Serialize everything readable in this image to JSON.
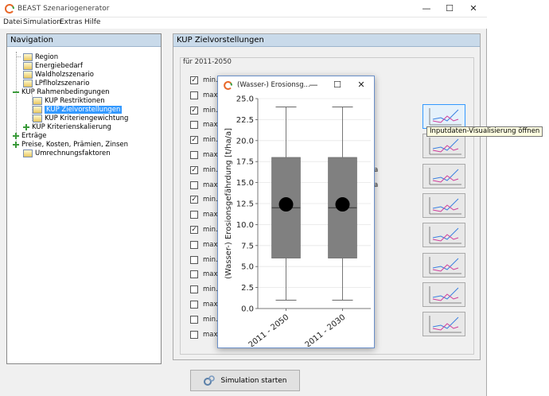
{
  "app": {
    "title": "BEAST Szenariogenerator",
    "window_buttons": {
      "minimize": "—",
      "maximize": "☐",
      "close": "✕"
    }
  },
  "menu": [
    "Datei",
    "Simulation",
    "Extras",
    "Hilfe"
  ],
  "navigation": {
    "header": "Navigation",
    "items": [
      {
        "label": "Region"
      },
      {
        "label": "Energiebedarf"
      },
      {
        "label": "Waldholzszenario"
      },
      {
        "label": "LPflholzszenario"
      },
      {
        "label": "KUP Rahmenbedingungen"
      },
      {
        "label": "KUP Restriktionen"
      },
      {
        "label": "KUP Zielvorstellungen"
      },
      {
        "label": "KUP Kriteriengewichtung"
      },
      {
        "label": "KUP Kriterienskalierung"
      },
      {
        "label": "Erträge"
      },
      {
        "label": "Preise, Kosten, Prämien, Zinsen"
      },
      {
        "label": "Umrechnungsfaktoren"
      }
    ]
  },
  "kup": {
    "header": "KUP Zielvorstellungen",
    "period": "für 2011-2050",
    "rows": [
      {
        "label": "min. /",
        "checked": true
      },
      {
        "label": "max.",
        "checked": false
      },
      {
        "label": "min. (",
        "checked": true
      },
      {
        "label": "max.",
        "checked": false
      },
      {
        "label": "min. I",
        "checked": true
      },
      {
        "label": "max.",
        "checked": false
      },
      {
        "label": "min. S",
        "checked": true
      },
      {
        "label": "max.",
        "checked": false
      },
      {
        "label": "min. (",
        "checked": true
      },
      {
        "label": "max.",
        "checked": false
      },
      {
        "label": "min. I",
        "checked": true
      },
      {
        "label": "max.",
        "checked": false
      },
      {
        "label": "min. (",
        "checked": false
      },
      {
        "label": "max.",
        "checked": false
      },
      {
        "label": "min. I",
        "checked": false
      },
      {
        "label": "max.",
        "checked": false
      },
      {
        "label": "min. I",
        "checked": false
      },
      {
        "label": "max.",
        "checked": false
      }
    ],
    "side_texts": [
      "a",
      "a"
    ],
    "check_glyph": "✓",
    "tooltip": "Inputdaten-Visualisierung öffnen",
    "simulate_button": "Simulation starten"
  },
  "popup": {
    "title": "(Wasser-) Erosionsg...",
    "window_buttons": {
      "minimize": "—",
      "maximize": "☐",
      "close": "✕"
    }
  },
  "colors": {
    "header_bg": "#c9daea",
    "selected": "#3399ff",
    "box_fill": "#808080"
  },
  "chart_data": {
    "type": "box",
    "ylabel": "(Wasser-) Erosionsgefährdung [t/ha/a]",
    "ylim": [
      0,
      25
    ],
    "yticks": [
      "0.0",
      "2.5",
      "5.0",
      "7.5",
      "10.0",
      "12.5",
      "15.0",
      "17.5",
      "20.0",
      "22.5",
      "25.0"
    ],
    "categories": [
      "2011 - 2050",
      "2011 - 2030"
    ],
    "boxes": [
      {
        "min": 1.0,
        "q1": 6.0,
        "median": 12.0,
        "q3": 18.0,
        "max": 24.0,
        "mean": 12.4
      },
      {
        "min": 1.0,
        "q1": 6.0,
        "median": 12.0,
        "q3": 18.0,
        "max": 24.0,
        "mean": 12.4
      }
    ]
  }
}
